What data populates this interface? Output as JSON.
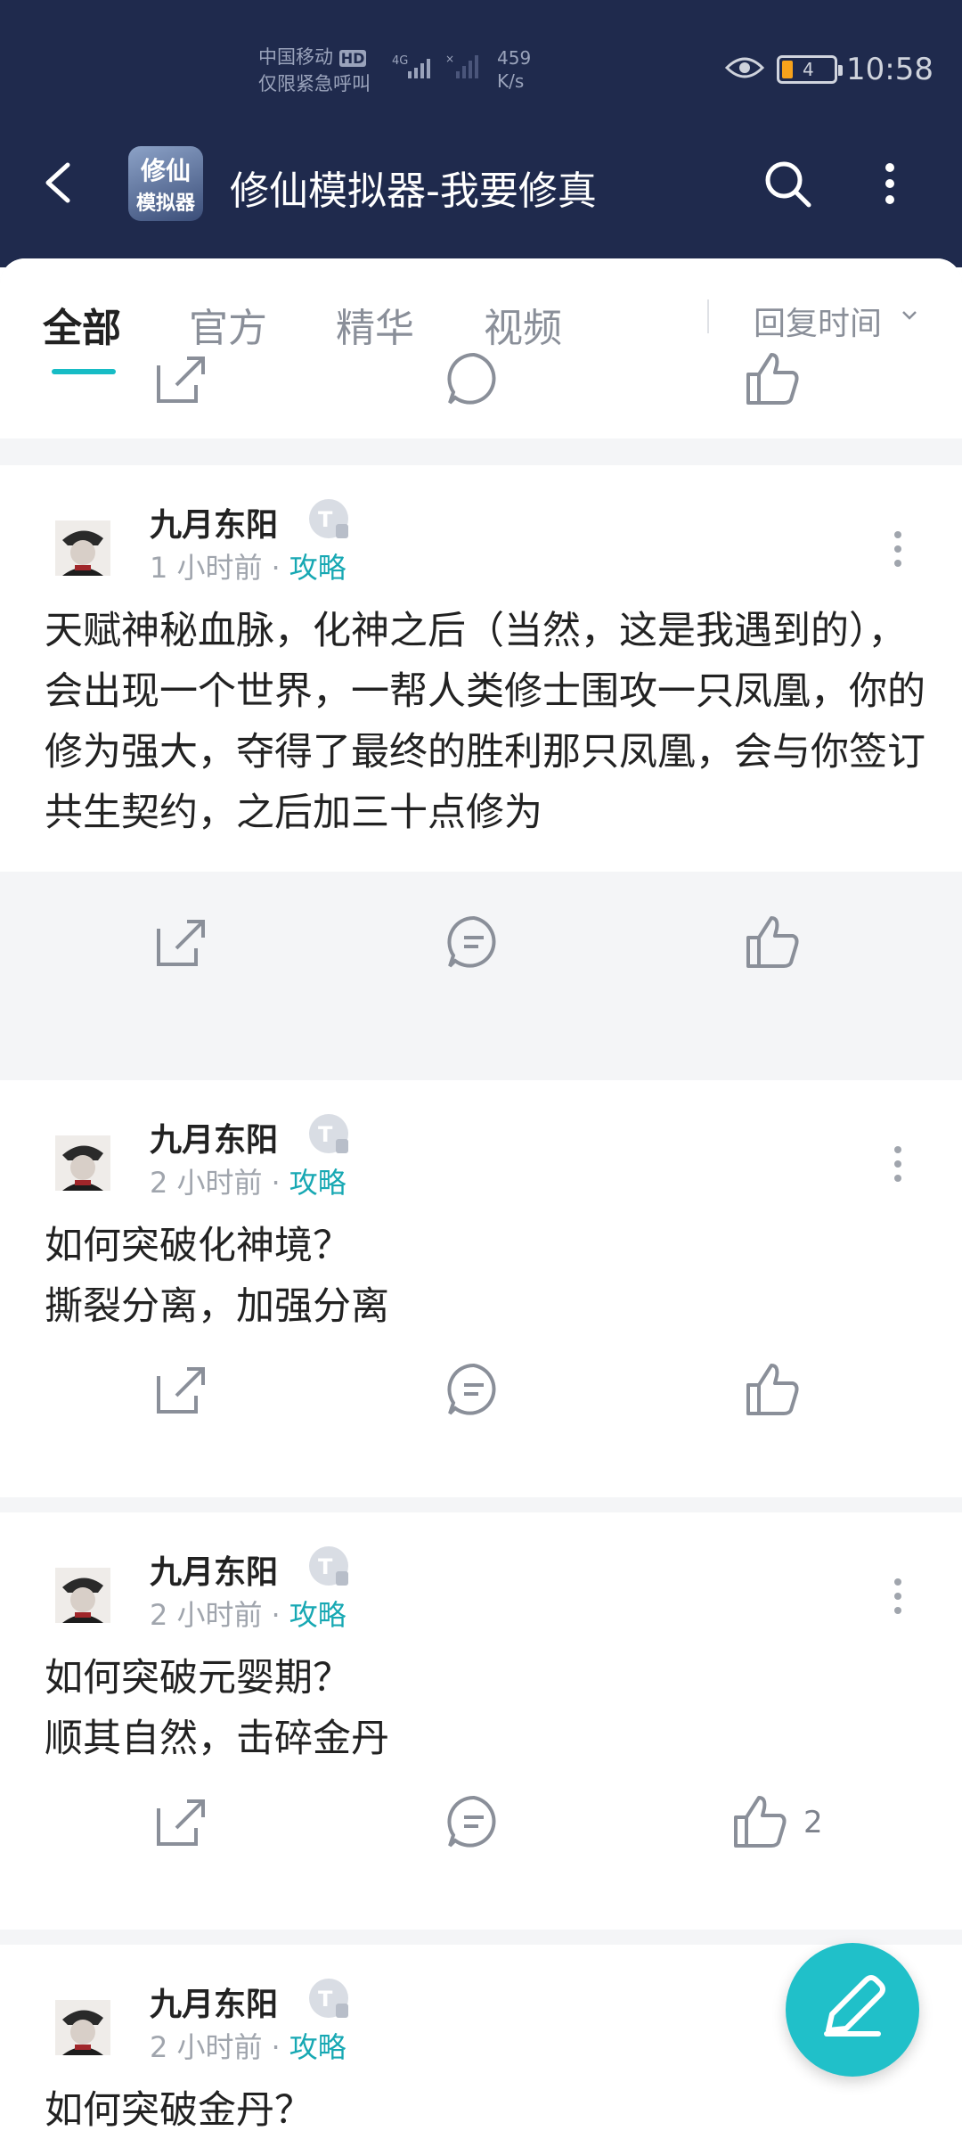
{
  "status_bar": {
    "carrier_line1": "中国移动",
    "hd": "HD",
    "carrier_line2": "仅限紧急呼叫",
    "network": "4G",
    "speed_value": "459",
    "speed_unit": "K/s",
    "battery": "4",
    "time": "10:58"
  },
  "header": {
    "app_icon_line1": "修仙",
    "app_icon_line2": "模拟器",
    "title": "修仙模拟器-我要修真"
  },
  "tabs": [
    {
      "label": "全部",
      "active": true
    },
    {
      "label": "官方",
      "active": false
    },
    {
      "label": "精华",
      "active": false
    },
    {
      "label": "视频",
      "active": false
    }
  ],
  "sort": {
    "label": "回复时间"
  },
  "posts": [
    {
      "author": "九月东阳",
      "time": "1 小时前",
      "separator": "·",
      "tag": "攻略",
      "text": "天赋神秘血脉，化神之后（当然，这是我遇到的），会出现一个世界，一帮人类修士围攻一只凤凰，你的修为强大，夺得了最终的胜利那只凤凰，会与你签订共生契约，之后加三十点修为",
      "likes": ""
    },
    {
      "author": "九月东阳",
      "time": "2 小时前",
      "separator": "·",
      "tag": "攻略",
      "text_line1": "如何突破化神境？",
      "text_line2": "撕裂分离，加强分离",
      "likes": ""
    },
    {
      "author": "九月东阳",
      "time": "2 小时前",
      "separator": "·",
      "tag": "攻略",
      "text_line1": "如何突破元婴期？",
      "text_line2": "顺其自然，击碎金丹",
      "likes": "2"
    },
    {
      "author": "九月东阳",
      "time": "2 小时前",
      "separator": "·",
      "tag": "攻略",
      "text_line1": "如何突破金丹？"
    }
  ],
  "colors": {
    "header_bg": "#1f2a4d",
    "accent": "#17bcc5",
    "fab": "#20c0c9"
  }
}
